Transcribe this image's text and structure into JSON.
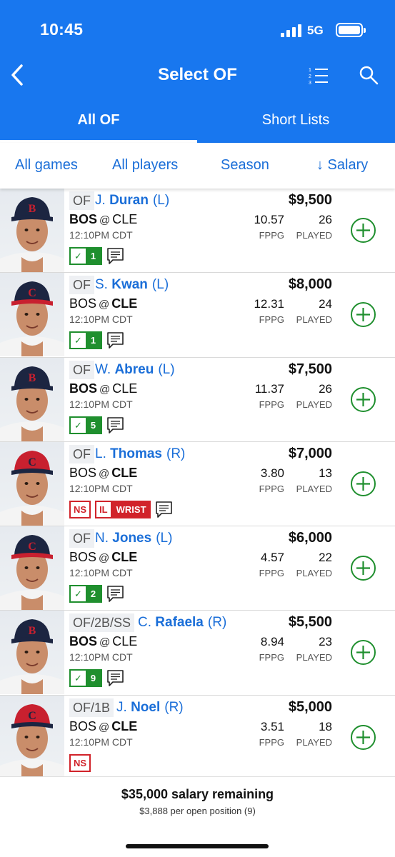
{
  "status": {
    "time": "10:45",
    "network": "5G"
  },
  "nav": {
    "title": "Select OF"
  },
  "tabs": [
    {
      "label": "All OF"
    },
    {
      "label": "Short Lists"
    }
  ],
  "filters": {
    "games": "All games",
    "players": "All players",
    "season": "Season",
    "sort": "↓ Salary"
  },
  "players": [
    {
      "pos": "OF",
      "initial": "J.",
      "last": "Duran",
      "hand": "(L)",
      "salary": "$9,500",
      "home": "BOS",
      "away": "CLE",
      "bold": "home",
      "time": "12:10PM CDT",
      "fppg": "10.57",
      "fppg_label": "FPPG",
      "played": "26",
      "played_label": "PLAYED",
      "check": "1",
      "cap": "boston"
    },
    {
      "pos": "OF",
      "initial": "S.",
      "last": "Kwan",
      "hand": "(L)",
      "salary": "$8,000",
      "home": "BOS",
      "away": "CLE",
      "bold": "away",
      "time": "12:10PM CDT",
      "fppg": "12.31",
      "fppg_label": "FPPG",
      "played": "24",
      "played_label": "PLAYED",
      "check": "1",
      "cap": "cleveland"
    },
    {
      "pos": "OF",
      "initial": "W.",
      "last": "Abreu",
      "hand": "(L)",
      "salary": "$7,500",
      "home": "BOS",
      "away": "CLE",
      "bold": "home",
      "time": "12:10PM CDT",
      "fppg": "11.37",
      "fppg_label": "FPPG",
      "played": "26",
      "played_label": "PLAYED",
      "check": "5",
      "cap": "boston"
    },
    {
      "pos": "OF",
      "initial": "L.",
      "last": "Thomas",
      "hand": "(R)",
      "salary": "$7,000",
      "home": "BOS",
      "away": "CLE",
      "bold": "away",
      "time": "12:10PM CDT",
      "fppg": "3.80",
      "fppg_label": "FPPG",
      "played": "13",
      "played_label": "PLAYED",
      "tags": [
        "NS",
        "IL",
        "WRIST"
      ],
      "cap": "cleveland-red"
    },
    {
      "pos": "OF",
      "initial": "N.",
      "last": "Jones",
      "hand": "(L)",
      "salary": "$6,000",
      "home": "BOS",
      "away": "CLE",
      "bold": "away",
      "time": "12:10PM CDT",
      "fppg": "4.57",
      "fppg_label": "FPPG",
      "played": "22",
      "played_label": "PLAYED",
      "check": "2",
      "cap": "cleveland"
    },
    {
      "pos": "OF/2B/SS",
      "initial": "C.",
      "last": "Rafaela",
      "hand": "(R)",
      "salary": "$5,500",
      "home": "BOS",
      "away": "CLE",
      "bold": "home",
      "time": "12:10PM CDT",
      "fppg": "8.94",
      "fppg_label": "FPPG",
      "played": "23",
      "played_label": "PLAYED",
      "check": "9",
      "cap": "boston"
    },
    {
      "pos": "OF/1B",
      "initial": "J.",
      "last": "Noel",
      "hand": "(R)",
      "salary": "$5,000",
      "home": "BOS",
      "away": "CLE",
      "bold": "away",
      "time": "12:10PM CDT",
      "fppg": "3.51",
      "fppg_label": "FPPG",
      "played": "18",
      "played_label": "PLAYED",
      "tags": [
        "NS"
      ],
      "cap": "cleveland-red"
    }
  ],
  "footer": {
    "remaining": "$35,000 salary remaining",
    "per_position": "$3,888 per open position (9)"
  },
  "colors": {
    "brand": "#1877ef",
    "link": "#1a6ed8",
    "add": "#1f8f2e",
    "alert": "#d1232a"
  }
}
